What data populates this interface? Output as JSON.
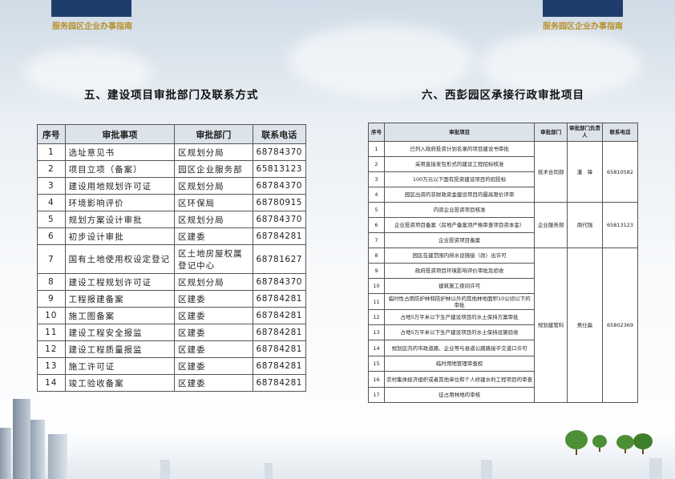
{
  "header": {
    "left_title": "服务园区企业办事指南",
    "right_title": "服务园区企业办事指南"
  },
  "left_page": {
    "section_title": "五、建设项目审批部门及联系方式",
    "columns": [
      "序号",
      "审批事项",
      "审批部门",
      "联系电话"
    ],
    "rows": [
      {
        "no": "1",
        "item": "选址意见书",
        "dept": "区规划分局",
        "phone": "68784370"
      },
      {
        "no": "2",
        "item": "项目立项（备案）",
        "dept": "园区企业服务部",
        "phone": "65813123"
      },
      {
        "no": "3",
        "item": "建设用地规划许可证",
        "dept": "区规划分局",
        "phone": "68784370"
      },
      {
        "no": "4",
        "item": "环境影响评价",
        "dept": "区环保局",
        "phone": "68780915"
      },
      {
        "no": "5",
        "item": "规划方案设计审批",
        "dept": "区规划分局",
        "phone": "68784370"
      },
      {
        "no": "6",
        "item": "初步设计审批",
        "dept": "区建委",
        "phone": "68784281"
      },
      {
        "no": "7",
        "item": "国有土地使用权设定登记",
        "dept": "区土地房屋权属登记中心",
        "phone": "68781627"
      },
      {
        "no": "8",
        "item": "建设工程规划许可证",
        "dept": "区规划分局",
        "phone": "68784370"
      },
      {
        "no": "9",
        "item": "工程报建备案",
        "dept": "区建委",
        "phone": "68784281"
      },
      {
        "no": "10",
        "item": "施工图备案",
        "dept": "区建委",
        "phone": "68784281"
      },
      {
        "no": "11",
        "item": "建设工程安全报监",
        "dept": "区建委",
        "phone": "68784281"
      },
      {
        "no": "12",
        "item": "建设工程质量报监",
        "dept": "区建委",
        "phone": "68784281"
      },
      {
        "no": "13",
        "item": "施工许可证",
        "dept": "区建委",
        "phone": "68784281"
      },
      {
        "no": "14",
        "item": "竣工验收备案",
        "dept": "区建委",
        "phone": "68784281"
      }
    ]
  },
  "right_page": {
    "section_title": "六、西彭园区承接行政审批项目",
    "columns": [
      "序号",
      "审批项目",
      "审批部门",
      "审批部门负责人",
      "联系电话"
    ],
    "groups": [
      {
        "dept": "技术合同部",
        "head": "潘　锋",
        "phone": "65810582",
        "rows": [
          {
            "no": "1",
            "item": "已列入政府投资计划名录的项目建设书审批"
          },
          {
            "no": "2",
            "item": "采用直接发包形式的建设工程招标核准"
          },
          {
            "no": "3",
            "item": "100万元以下国有投资建设项目的招投标"
          },
          {
            "no": "4",
            "item": "园区出资的非财政资金建设项目的最高限价评审"
          }
        ]
      },
      {
        "dept": "企业服务部",
        "head": "周代强",
        "phone": "65813123",
        "rows": [
          {
            "no": "5",
            "item": "内资企业投资项目核准"
          },
          {
            "no": "6",
            "item": "企业投资项目备案（房地产备案须严格审查项目资本金）"
          },
          {
            "no": "7",
            "item": "企业投资项目备案"
          }
        ]
      },
      {
        "dept": "规划建管科",
        "head": "吴仕磊",
        "phone": "65802369",
        "rows": [
          {
            "no": "8",
            "item": "园区在建范围内排水设施接（改）出许可"
          },
          {
            "no": "9",
            "item": "政府投资项目环境影响评价审批及验收"
          },
          {
            "no": "10",
            "item": "建筑施工夜间许可"
          },
          {
            "no": "11",
            "item": "临时性占用防护林和防护林以外的其他林地面积10公顷以下的审批"
          },
          {
            "no": "12",
            "item": "占地5万平米以下生产建设项目的水土保持方案审批"
          },
          {
            "no": "13",
            "item": "占地5万平米以下生产建设项目的水土保持设施验收"
          },
          {
            "no": "14",
            "item": "规划区内的市政道路、企业等与县道公路路接平交道口许可"
          },
          {
            "no": "15",
            "item": "临时用地管理审查权"
          },
          {
            "no": "16",
            "item": "农村集体经济组织或者其他单位和个人修建水利工程项目的审查"
          },
          {
            "no": "17",
            "item": "征占用林地的审核"
          }
        ]
      }
    ]
  },
  "colors": {
    "header_bar": "#1f3d6b",
    "header_text": "#b8912e",
    "table_head_bg": "#dde3ea"
  }
}
